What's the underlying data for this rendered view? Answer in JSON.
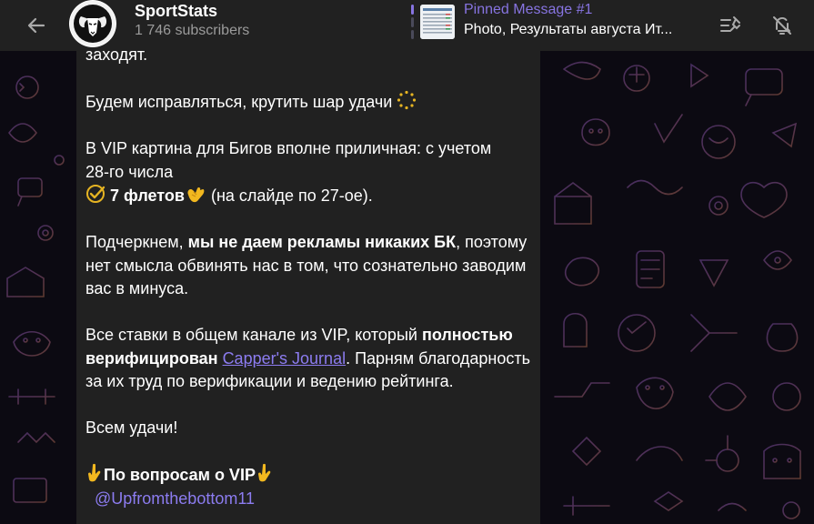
{
  "header": {
    "channel_name": "SportStats",
    "subscribers": "1 746 subscribers",
    "pinned_title": "Pinned Message #1",
    "pinned_text": "Photo, Результаты августа Ит..."
  },
  "message": {
    "line_fragment": "заходят.",
    "p1": "Будем исправляться, крутить шар удачи",
    "p2_line1": "В VIP картина для Бигов вполне приличная: с учетом",
    "p2_line2": "28-го числа",
    "p2_bold": "7 флетов",
    "p2_rest": "(на слайде по 27-ое).",
    "p3_plain1": "Подчеркнем, ",
    "p3_bold": "мы не даем рекламы никаких БК",
    "p3_plain2": ", поэтому нет смысла обвинять нас в том, что сознательно заводим вас в минуса.",
    "p4_plain1": "Все ставки в общем канале из VIP, который ",
    "p4_bold": "полностью верифицирован",
    "p4_link": "Capper's Journal",
    "p4_plain2": ". Парням благодарность за их труд по верификации и ведению рейтинга.",
    "p5": "Всем удачи!",
    "vip_label": "По вопросам о VIP",
    "contact": "@Upfromthebottom11"
  },
  "icons": {
    "back": "arrow-left-icon",
    "pinned_list": "pin-list-icon",
    "mute": "bell-off-icon",
    "roulette": "dotted-circle-icon",
    "check": "checkmark-circle-icon",
    "hands": "clapping-hands-icon",
    "point_down": "pointing-down-icon"
  },
  "colors": {
    "header_bg": "#212121",
    "bubble_bg": "#212121",
    "accent": "#8774e1",
    "link": "#8c7cf0",
    "subtitle": "#9b9b9b"
  }
}
